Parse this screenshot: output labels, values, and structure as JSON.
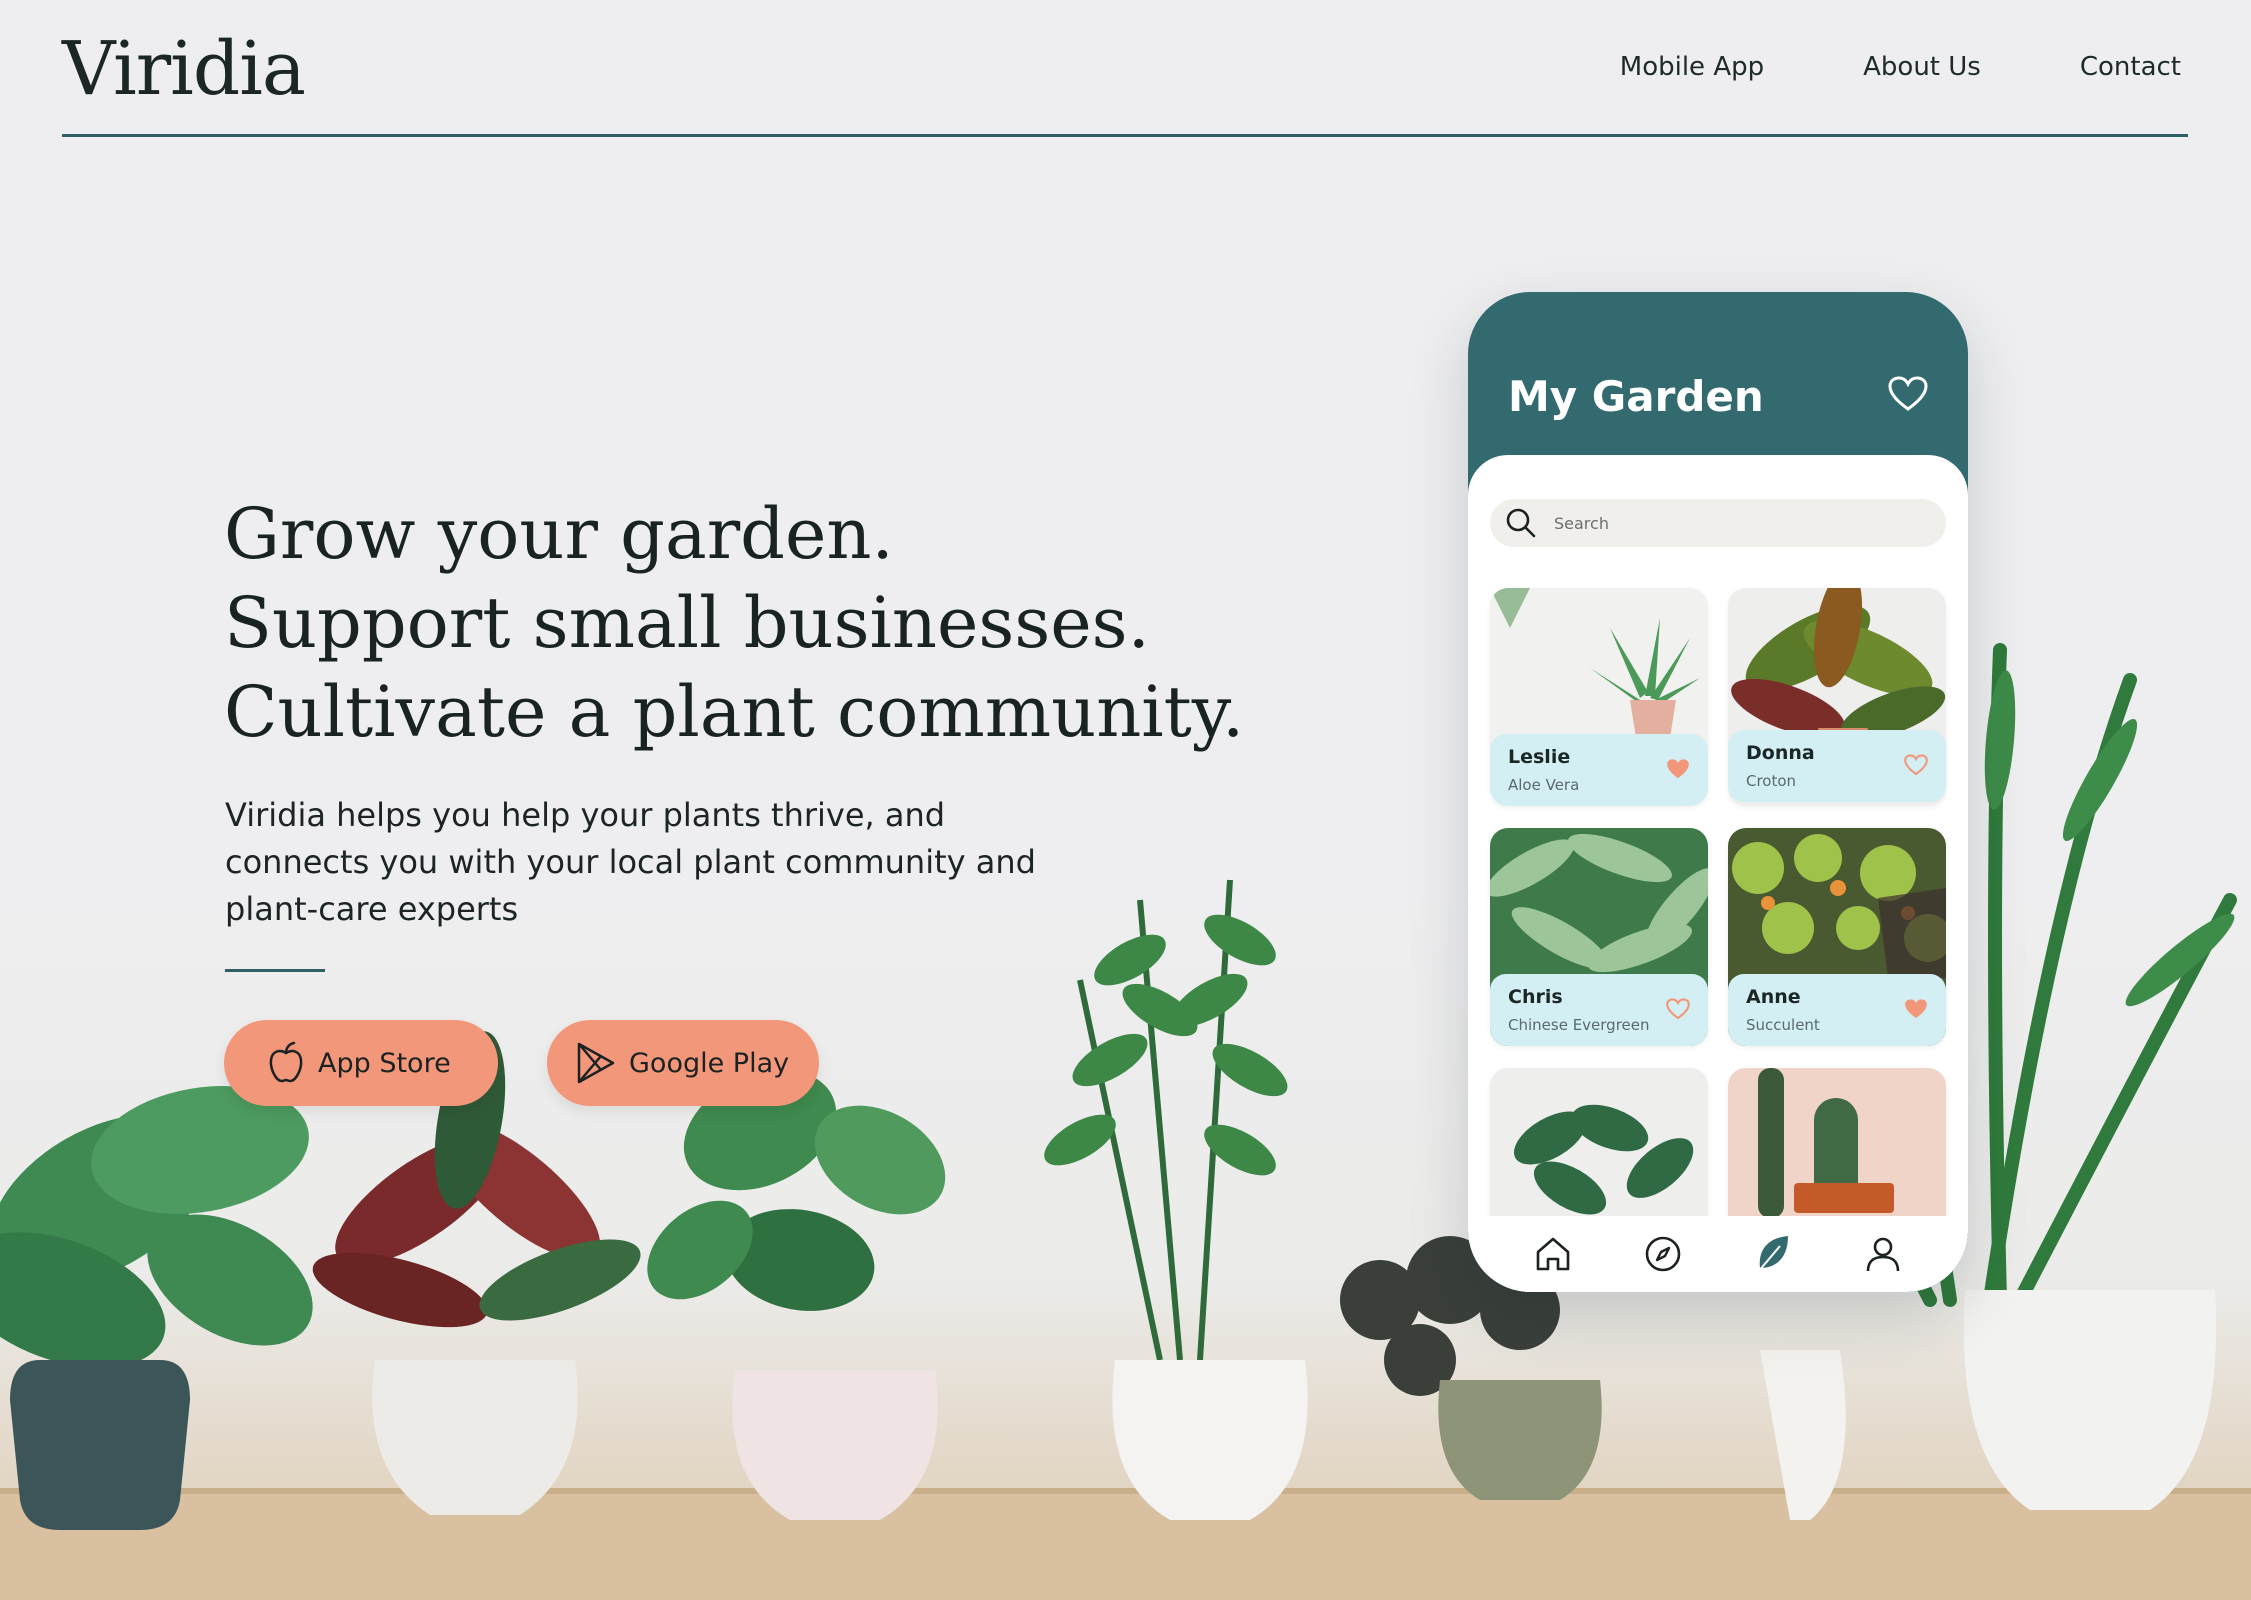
{
  "header": {
    "logo": "Viridia",
    "nav": [
      {
        "label": "Mobile App"
      },
      {
        "label": "About Us"
      },
      {
        "label": "Contact"
      }
    ]
  },
  "hero": {
    "headline": [
      "Grow your garden.",
      "Support small businesses.",
      "Cultivate a plant community."
    ],
    "lede": [
      "Viridia helps you help your plants thrive, and",
      "connects you with your local plant community and",
      "plant-care experts"
    ],
    "buttons": {
      "app_store": "App Store",
      "google_play": "Google Play"
    }
  },
  "phone": {
    "title": "My Garden",
    "search_placeholder": "Search",
    "cards": [
      {
        "name": "Leslie",
        "plant": "Aloe Vera",
        "favorited": true
      },
      {
        "name": "Donna",
        "plant": "Croton",
        "favorited": false
      },
      {
        "name": "Chris",
        "plant": "Chinese Evergreen",
        "favorited": false
      },
      {
        "name": "Anne",
        "plant": "Succulent",
        "favorited": true
      }
    ],
    "tabs": [
      "home-icon",
      "compass-icon",
      "leaf-icon",
      "profile-icon"
    ]
  },
  "colors": {
    "brand_teal": "#326a70",
    "accent_coral": "#f2977a",
    "card_label_bg": "#d3eff4",
    "text_dark": "#1b2626"
  }
}
